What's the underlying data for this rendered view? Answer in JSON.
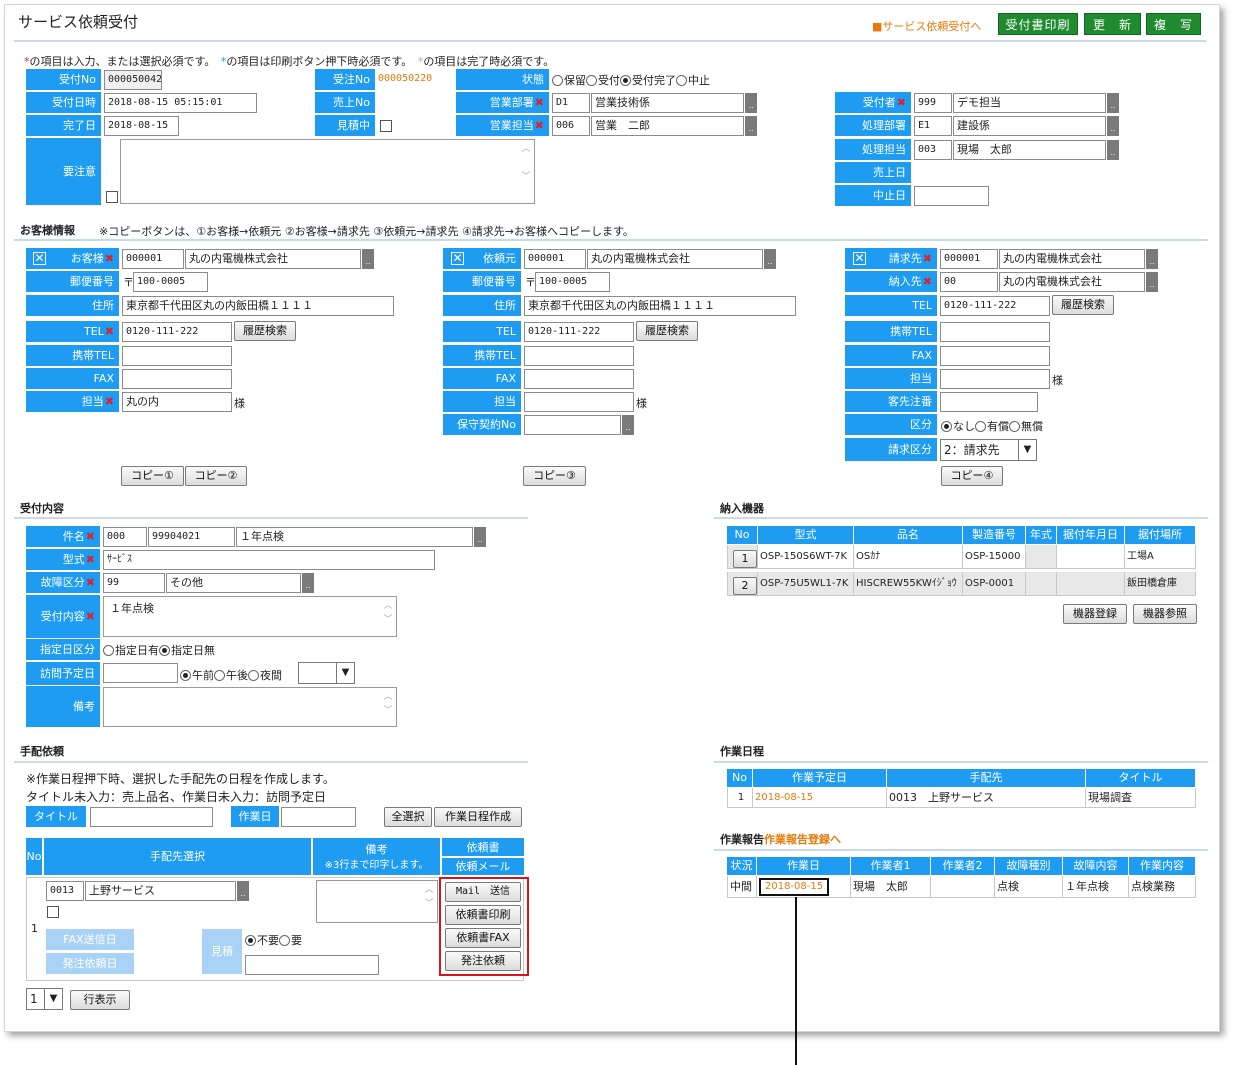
{
  "header": {
    "title": "サービス依頼受付",
    "link": "■サービス依頼受付へ",
    "print": "受付書印刷",
    "update": "更　新",
    "copy": "複　写"
  },
  "notes": {
    "n1": "の項目は入力、または選択必須です。",
    "n2": "の項目は印刷ボタン押下時必須です。",
    "n3": "の項目は完了時必須です。",
    "mark": "*"
  },
  "top": {
    "uketsuke_no_label": "受付No",
    "uketsuke_no": "000050042",
    "uketsuke_dt_label": "受付日時",
    "uketsuke_dt": "2018-08-15 05:15:01",
    "kanryo_label": "完了日",
    "kanryo": "2018-08-15",
    "youchui_label": "要注意",
    "juchu_label": "受注No",
    "juchu": "000050220",
    "uriage_label": "売上No",
    "mitsumori_label": "見積中",
    "status_label": "状態",
    "status_opts": [
      "保留",
      "受付",
      "受付完了",
      "中止"
    ],
    "eigyo_bu_label": "営業部署",
    "eigyo_bu_code": "D1",
    "eigyo_bu_name": "営業技術係",
    "eigyo_tan_label": "営業担当",
    "eigyo_tan_code": "006",
    "eigyo_tan_name": "営業　二郎",
    "uketsukesha_label": "受付者",
    "uketsukesha_code": "999",
    "uketsukesha_name": "デモ担当",
    "shori_bu_label": "処理部署",
    "shori_bu_code": "E1",
    "shori_bu_name": "建設係",
    "shori_tan_label": "処理担当",
    "shori_tan_code": "003",
    "shori_tan_name": "現場　太郎",
    "uriagebi_label": "売上日",
    "chushi_label": "中止日"
  },
  "customer": {
    "section": "お客様情報",
    "note": "※コピーボタンは、①お客様→依頼元 ②お客様→請求先 ③依頼元→請求先 ④請求先→お客様へコピーします。",
    "c_label": "お客様",
    "c_code": "000001",
    "c_name": "丸の内電機株式会社",
    "zip_label": "郵便番号",
    "zip_mark": "〒",
    "zip": "100-0005",
    "addr_label": "住所",
    "addr": "東京都千代田区丸の内飯田橋１１１１",
    "tel_label": "TEL",
    "tel": "0120-111-222",
    "history": "履歴検索",
    "mobile_label": "携帯TEL",
    "fax_label": "FAX",
    "tanto_label": "担当",
    "tanto": "丸の内",
    "sama": "様",
    "copy1": "コピー①",
    "copy2": "コピー②",
    "r_label": "依頼元",
    "r_code": "000001",
    "r_name": "丸の内電機株式会社",
    "r_zip": "100-0005",
    "r_addr": "東京都千代田区丸の内飯田橋１１１１",
    "r_tel": "0120-111-222",
    "hoshu_label": "保守契約No",
    "copy3": "コピー③",
    "b_label": "請求先",
    "b_code": "000001",
    "b_name": "丸の内電機株式会社",
    "n_label": "納入先",
    "n_code": "00",
    "n_name": "丸の内電機株式会社",
    "b_tel": "0120-111-222",
    "kyaku_label": "客先注番",
    "kubun_label": "区分",
    "kubun_opts": [
      "なし",
      "有償",
      "無償"
    ],
    "seikyu_kubun_label": "請求区分",
    "seikyu_kubun": "2：請求先",
    "copy4": "コピー④"
  },
  "reception": {
    "section": "受付内容",
    "kenmei_label": "件名",
    "kenmei_code": "000",
    "kenmei_no": "99904021",
    "kenmei": "１年点検",
    "katashiki_label": "型式",
    "katashiki": "ｻｰﾋﾞｽ",
    "kosho_label": "故障区分",
    "kosho_code": "99",
    "kosho": "その他",
    "naiyo_label": "受付内容",
    "naiyo": "１年点検",
    "shitei_label": "指定日区分",
    "shitei_opts": [
      "指定日有",
      "指定日無"
    ],
    "homon_label": "訪問予定日",
    "homon_opts": [
      "午前",
      "午後",
      "夜間"
    ],
    "biko_label": "備考"
  },
  "equipment": {
    "section": "納入機器",
    "cols": [
      "No",
      "型式",
      "品名",
      "製造番号",
      "年式",
      "据付年月日",
      "据付場所"
    ],
    "rows": [
      {
        "no": "1",
        "model": "OSP-150S6WT-7K",
        "name": "OSｶﾅ",
        "serial": "OSP-15000",
        "year": "",
        "date": "",
        "place": "工場A"
      },
      {
        "no": "2",
        "model": "OSP-75U5WL1-7K",
        "name": "HISCREW55KWｲｼﾞｮｳ",
        "serial": "OSP-0001",
        "year": "",
        "date": "",
        "place": "飯田橋倉庫"
      }
    ],
    "register": "機器登録",
    "reference": "機器参照"
  },
  "arrangement": {
    "section": "手配依頼",
    "note1": "※作業日程押下時、選択した手配先の日程を作成します。",
    "note2": "タイトル未入力：売上品名、作業日未入力：訪問予定日",
    "title_label": "タイトル",
    "date_label": "作業日",
    "select_all": "全選択",
    "create": "作業日程作成",
    "col_no": "No",
    "col_sel": "手配先選択",
    "col_biko": "備考",
    "col_biko_note": "※3行まで印字します。",
    "col_req": "依頼書",
    "col_mail": "依頼メール",
    "row_no": "1",
    "code": "0013",
    "name": "上野サービス",
    "fax_label": "FAX送信日",
    "order_label": "発注依頼日",
    "mitsu_label": "見積",
    "mitsu_opts": [
      "不要",
      "要"
    ],
    "mail_btn": "Mail　送信",
    "print_btn": "依頼書印刷",
    "fax_btn": "依頼書FAX",
    "order_btn": "発注依頼",
    "rows_sel": "1",
    "rows_btn": "行表示"
  },
  "schedule": {
    "section": "作業日程",
    "cols": [
      "No",
      "作業予定日",
      "手配先",
      "タイトル"
    ],
    "rows": [
      {
        "no": "1",
        "date": "2018-08-15",
        "vendor": "0013　上野サービス",
        "title": "現場調査"
      }
    ]
  },
  "report": {
    "section": "作業報告",
    "link": "作業報告登録へ",
    "cols": [
      "状況",
      "作業日",
      "作業者1",
      "作業者2",
      "故障種別",
      "故障内容",
      "作業内容"
    ],
    "rows": [
      {
        "status": "中間",
        "date": "2018-08-15",
        "w1": "現場　太郎",
        "w2": "",
        "kind": "点検",
        "content": "１年点検",
        "work": "点検業務"
      }
    ]
  },
  "colors": {
    "accent": "#1e9cf2",
    "green": "#1f8a2e",
    "orange": "#e87a0a",
    "required": "#e0202a",
    "highlight": "#d9141e"
  }
}
